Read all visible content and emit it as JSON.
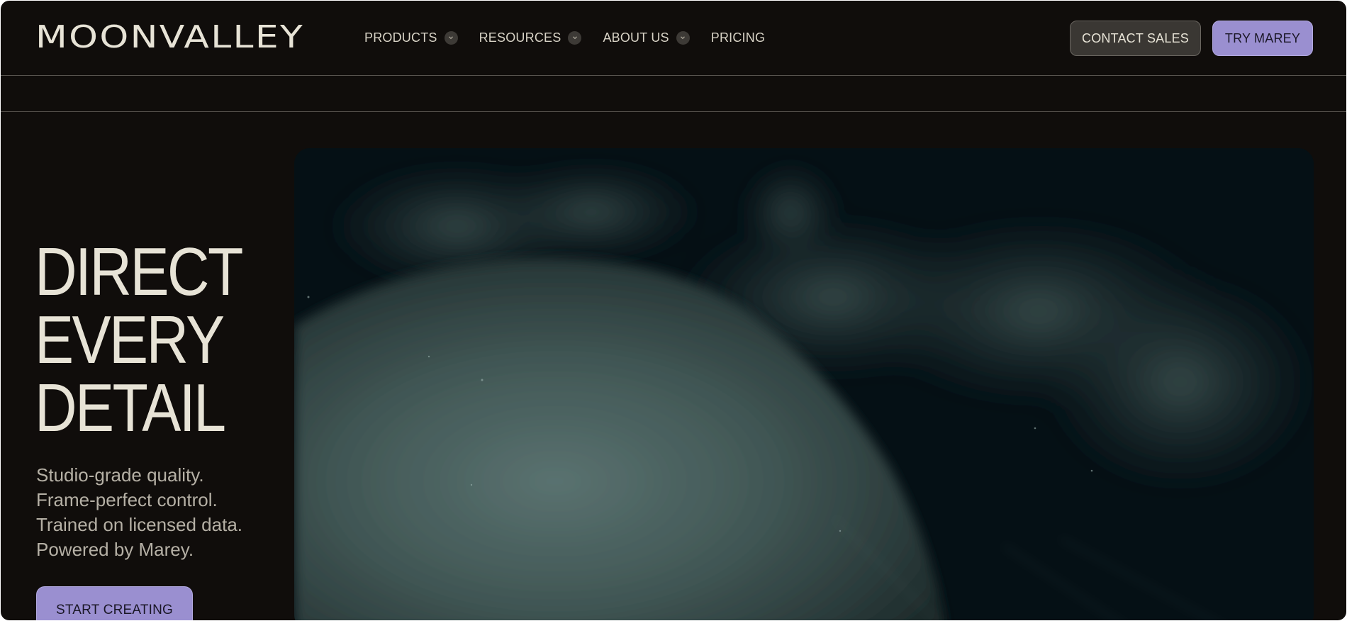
{
  "brand": {
    "logo": "MOONVALLEY"
  },
  "nav": {
    "items": [
      {
        "label": "PRODUCTS",
        "has_dropdown": true
      },
      {
        "label": "RESOURCES",
        "has_dropdown": true
      },
      {
        "label": "ABOUT US",
        "has_dropdown": true
      },
      {
        "label": "PRICING",
        "has_dropdown": false
      }
    ],
    "contact_label": "CONTACT SALES",
    "try_label": "TRY MAREY"
  },
  "hero": {
    "headline": [
      "DIRECT",
      "EVERY",
      "DETAIL"
    ],
    "subtitle": [
      "Studio-grade quality.",
      "Frame-perfect control.",
      "Trained on licensed data.",
      "Powered by Marey."
    ],
    "cta_label": "START CREATING"
  },
  "colors": {
    "background": "#100d0b",
    "text": "#e7e3d6",
    "accent": "#9a8fd0",
    "muted": "#b5b0a5"
  }
}
